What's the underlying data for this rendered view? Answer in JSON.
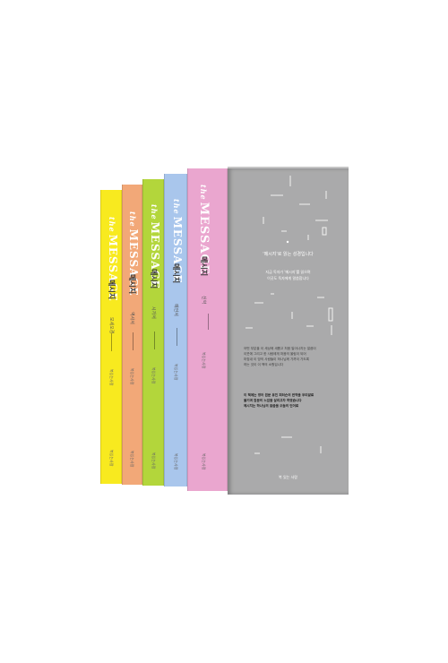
{
  "books": [
    {
      "logo": "MESSAGE",
      "logo_prefix": "the",
      "title": "메시지",
      "subtitle": "모세오경",
      "publisher": "복있는사람",
      "color": "#f8ea1f"
    },
    {
      "logo": "MESSAGE",
      "logo_prefix": "the",
      "title": "메시지",
      "subtitle": "역사서",
      "publisher": "복있는사람",
      "color": "#f2a878"
    },
    {
      "logo": "MESSAGE",
      "logo_prefix": "the",
      "title": "메시지",
      "subtitle": "시가서",
      "publisher": "복있는사람",
      "color": "#b3d63b"
    },
    {
      "logo": "MESSAGE",
      "logo_prefix": "the",
      "title": "메시지",
      "subtitle": "예언서",
      "publisher": "복있는사람",
      "color": "#a9c6ec"
    },
    {
      "logo": "MESSAGE",
      "logo_prefix": "the",
      "title": "메시지",
      "subtitle": "신약",
      "publisher": "복있는사람",
      "color": "#eaa6cf"
    }
  ],
  "case": {
    "color": "#aaaaab",
    "quote": "'메시지'로 읽는 성경입니다",
    "desc_lines": [
      "지금 독자가 '메시지'를 읽으며",
      "이곳도 독자에게 말씀합니다"
    ],
    "paragraph1": [
      "어떤 부분을 이 세상에 새롭고 처음 일어나지는 말씀이",
      "이웃에 그리고 한 사람에게 마음의 울림이 되어",
      "마침내 이 땅의 사람들이 하나님께 가까이 가도록",
      "하는 것이 이 책의 소원입니다"
    ],
    "paragraph2": [
      "이 책에는 영어 원문 유진 피터슨의 번역을 우리말로",
      "옮기며 원문의 느낌을 살리고자 하였습니다",
      "메시지는 하나님의 말씀을 오늘의 언어로"
    ],
    "publisher": "복 있는 사람"
  }
}
